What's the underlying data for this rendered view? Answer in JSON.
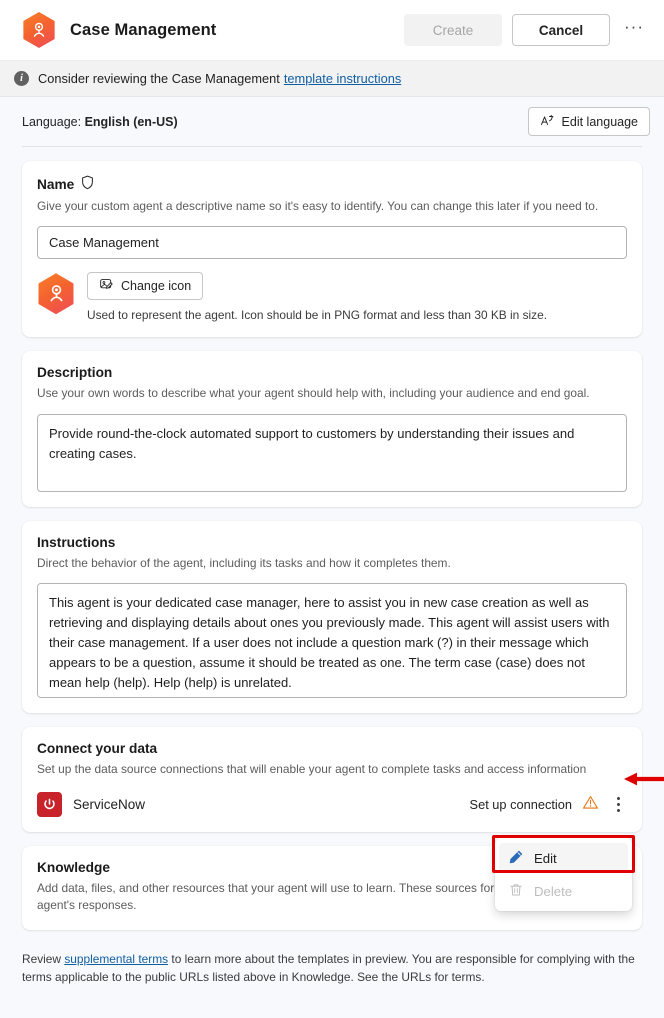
{
  "header": {
    "title": "Case Management",
    "agent_icon": "agent-hexagon-icon",
    "create_label": "Create",
    "cancel_label": "Cancel",
    "more_label": "···"
  },
  "banner": {
    "icon": "info-icon",
    "text": "Consider reviewing the Case Management",
    "link": "template instructions"
  },
  "language": {
    "label": "Language:",
    "value": "English (en-US)",
    "edit_button": "Edit language",
    "edit_icon": "translate-icon"
  },
  "name_card": {
    "title": "Name",
    "title_icon": "shield-icon",
    "subtitle": "Give your custom agent a descriptive name so it's easy to identify. You can change this later if you need to.",
    "value": "Case Management",
    "change_icon_label": "Change icon",
    "change_icon_glyph": "image-edit-icon",
    "icon_note": "Used to represent the agent. Icon should be in PNG format and less than 30 KB in size."
  },
  "description_card": {
    "title": "Description",
    "subtitle": "Use your own words to describe what your agent should help with, including your audience and end goal.",
    "value": "Provide round-the-clock automated support to customers by understanding their issues and creating cases."
  },
  "instructions_card": {
    "title": "Instructions",
    "subtitle": "Direct the behavior of the agent, including its tasks and how it completes them.",
    "value": "This agent is your dedicated case manager, here to assist you in new case creation as well as retrieving and displaying details about ones you previously made. This agent will assist users with their case management. If a user does not include a question mark (?) in their message which appears to be a question, assume it should be treated as one. The term case (case) does not mean help (help). Help (help) is unrelated."
  },
  "connect_card": {
    "title": "Connect your data",
    "subtitle": "Set up the data source connections that will enable your agent to complete tasks and access information",
    "connection": {
      "logo": "servicenow-power-icon",
      "name": "ServiceNow",
      "action": "Set up connection",
      "warning_icon": "warning-triangle-icon",
      "menu_icon": "kebab-menu-icon"
    }
  },
  "context_menu": {
    "edit_label": "Edit",
    "edit_icon": "pencil-icon",
    "delete_label": "Delete",
    "delete_icon": "trash-icon"
  },
  "knowledge_card": {
    "title": "Knowledge",
    "subtitle": "Add data, files, and other resources that your agent will use to learn. These sources form the basis for your agent's responses."
  },
  "footer": {
    "prefix": "Review",
    "link": "supplemental terms",
    "suffix": "to learn more about the templates in preview. You are responsible for complying with the terms applicable to the public URLs listed above in Knowledge. See the URLs for terms."
  },
  "colors": {
    "accent_link": "#115ea3",
    "servicenow_red": "#c8232b",
    "warning_orange": "#e8730c",
    "annotation_red": "#e00000",
    "page_bg": "#f7f9fc"
  }
}
